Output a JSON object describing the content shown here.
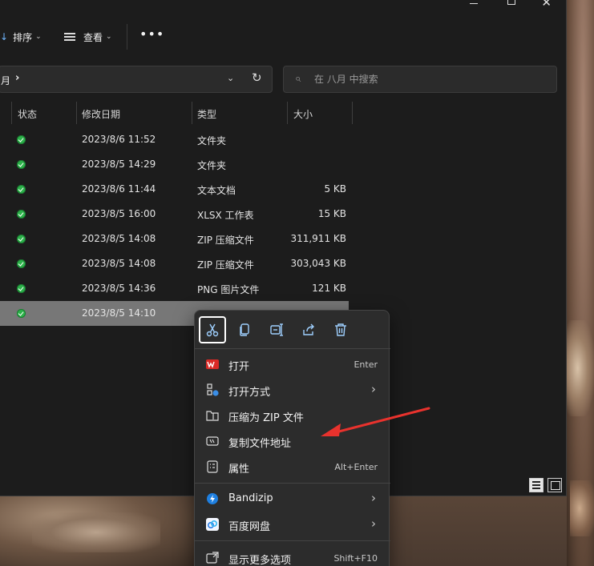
{
  "toolbar": {
    "sort_label": "排序",
    "view_label": "查看",
    "more_label": "•••"
  },
  "address": {
    "crumb": "月",
    "separator": "›"
  },
  "search": {
    "placeholder": "在 八月 中搜索"
  },
  "columns": {
    "status": "状态",
    "modified": "修改日期",
    "type": "类型",
    "size": "大小"
  },
  "files": [
    {
      "date": "2023/8/6 11:52",
      "type": "文件夹",
      "size": ""
    },
    {
      "date": "2023/8/5 14:29",
      "type": "文件夹",
      "size": ""
    },
    {
      "date": "2023/8/6 11:44",
      "type": "文本文档",
      "size": "5 KB"
    },
    {
      "date": "2023/8/5 16:00",
      "type": "XLSX 工作表",
      "size": "15 KB"
    },
    {
      "date": "2023/8/5 14:08",
      "type": "ZIP 压缩文件",
      "size": "311,911 KB"
    },
    {
      "date": "2023/8/5 14:08",
      "type": "ZIP 压缩文件",
      "size": "303,043 KB"
    },
    {
      "date": "2023/8/5 14:36",
      "type": "PNG 图片文件",
      "size": "121 KB"
    },
    {
      "date": "2023/8/5 14:10",
      "type": "",
      "size": ""
    }
  ],
  "context_menu": {
    "quick_actions": [
      "cut",
      "copy",
      "rename",
      "share",
      "delete"
    ],
    "items": [
      {
        "label": "打开",
        "shortcut": "Enter",
        "icon": "wps-icon"
      },
      {
        "label": "打开方式",
        "submenu": true,
        "icon": "open-with-icon"
      },
      {
        "label": "压缩为 ZIP 文件",
        "icon": "zip-icon"
      },
      {
        "label": "复制文件地址",
        "icon": "copy-path-icon"
      },
      {
        "label": "属性",
        "shortcut": "Alt+Enter",
        "icon": "properties-icon"
      },
      {
        "label": "Bandizip",
        "submenu": true,
        "icon": "bandizip-icon"
      },
      {
        "label": "百度网盘",
        "submenu": true,
        "icon": "baidu-netdisk-icon"
      },
      {
        "label": "显示更多选项",
        "shortcut": "Shift+F10",
        "icon": "more-options-icon"
      }
    ]
  },
  "colors": {
    "annotation_arrow": "#e8322d",
    "status_ok": "#2db24a",
    "selected_row": "#777777"
  }
}
